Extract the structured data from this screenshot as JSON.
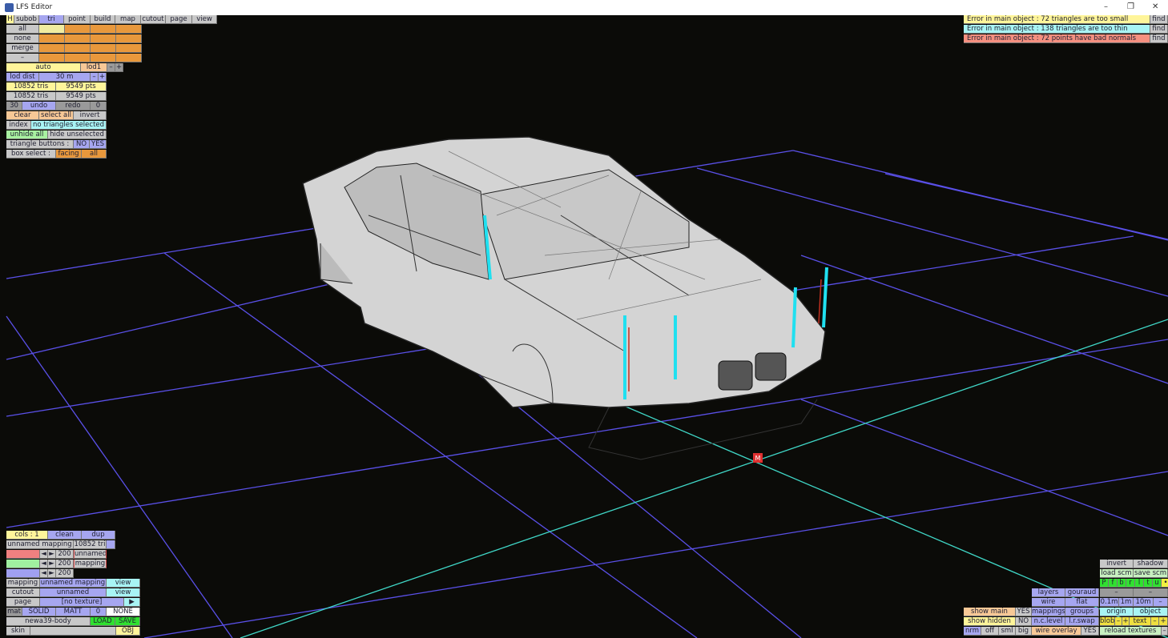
{
  "window": {
    "title": "LFS Editor",
    "minimize": "–",
    "restore": "❐",
    "close": "✕"
  },
  "menu": {
    "h": "H",
    "subob": "subob",
    "tri": "tri",
    "point": "point",
    "build": "build",
    "map": "map",
    "cutout": "cutout",
    "page": "page",
    "view": "view"
  },
  "select": {
    "all": "all",
    "none": "none",
    "merge": "merge",
    "dash": "–"
  },
  "lod": {
    "auto": "auto",
    "lod1": "lod1",
    "minus": "–",
    "plus": "+",
    "dist_label": "lod dist",
    "dist_value": "30 m"
  },
  "counts": {
    "tris1": "10852 tris",
    "pts1": "9549 pts",
    "tris2": "10852 tris",
    "pts2": "9549 pts"
  },
  "history": {
    "undo_count": "30",
    "undo": "undo",
    "redo": "redo",
    "redo_count": "0"
  },
  "actions": {
    "clear": "clear",
    "select_all": "select all",
    "invert": "invert",
    "index": "index",
    "selection_status": "no triangles selected",
    "unhide_all": "unhide all",
    "hide_unselected": "hide unselected",
    "triangle_buttons": "triangle buttons :",
    "no": "NO",
    "yes": "YES",
    "box_select": "box select :",
    "facing": "facing",
    "all": "all"
  },
  "errors": [
    {
      "text": "Error in main object : 72 triangles are too small",
      "find": "find",
      "color": "#fff59a"
    },
    {
      "text": "Error in main object : 138 triangles are too thin",
      "find": "find",
      "color": "#a8f4f4"
    },
    {
      "text": "Error in main object : 72 points have bad normals",
      "find": "find",
      "color": "#f59080"
    }
  ],
  "mapping_panel": {
    "cols": "cols : 1",
    "clean": "clean",
    "dup": "dup",
    "mapping_name": "unnamed mapping",
    "tri_count": "10852 tri",
    "v1": "200",
    "v2": "200",
    "v3": "200",
    "preview1": "unnamed",
    "preview2": "mapping",
    "mapping_label": "mapping",
    "mapping_value": "unnamed mapping",
    "view": "view",
    "cutout_label": "cutout",
    "cutout_value": "unnamed",
    "page_label": "page",
    "page_value": "[no texture]",
    "page_arrow": "▶",
    "mat": "mat",
    "solid": "SOLID",
    "matt": "MATT",
    "zero": "0",
    "none": "NONE",
    "file": "newa39-body",
    "load": "LOAD",
    "save": "SAVE",
    "skin": "skin",
    "obj": "OBJ",
    "left": "◄",
    "right": "►"
  },
  "view_panel": {
    "invert": "invert",
    "shadow": "shadow",
    "load_scm": "load scm",
    "save_scm": "save scm",
    "letters": [
      "P",
      "f",
      "b",
      "r",
      "l",
      "t",
      "u",
      "•"
    ],
    "layers": "layers",
    "gouraud": "gouraud",
    "dash": "–",
    "wire": "wire",
    "flat": "flat",
    "d01": "0.1m",
    "d1": "1m",
    "d10": "10m",
    "show_main": "show main",
    "show_main_val": "YES",
    "mappings": "mappings",
    "groups": "groups",
    "origin": "origin",
    "object": "object",
    "show_hidden": "show hidden",
    "show_hidden_val": "NO",
    "nc_level": "n.c.level",
    "lr_swap": "l.r.swap",
    "blob": "blob",
    "minus": "–",
    "plus": "+",
    "text": "text",
    "nrm": "nrm",
    "off": "off",
    "sml": "sml",
    "big": "big",
    "wire_overlay": "wire overlay",
    "wire_overlay_val": "YES",
    "reload": "reload textures"
  },
  "scene": {
    "marker": "M",
    "grid_color": "#5a50e8",
    "axis_color": "#40d8c8"
  }
}
